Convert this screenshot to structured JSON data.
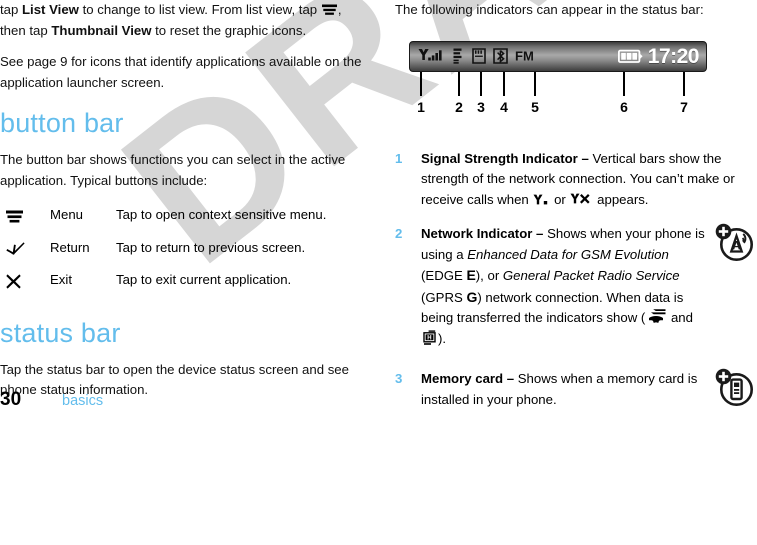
{
  "document": {
    "watermark": "DRAFT",
    "accent_color": "#63bdec",
    "page_number": "30",
    "chapter": "basics"
  },
  "left_column": {
    "intro_paragraph": {
      "before_bold1": "tap ",
      "bold1": "List View",
      "mid": " to change to list view. From list view, tap ",
      "icon1": "menu-icon",
      "after_icon": ", then tap ",
      "bold2": "Thumbnail View",
      "tail": " to reset the graphic icons."
    },
    "see_page_paragraph": "See page 9 for icons that identify applications available on the application launcher screen.",
    "button_bar": {
      "heading": "button bar",
      "description": "The button bar shows functions you can select in the active application. Typical buttons include:",
      "rows": [
        {
          "icon": "menu-icon",
          "term": "Menu",
          "description": "Tap to open context sensitive menu."
        },
        {
          "icon": "return-arrow-icon",
          "term": "Return",
          "description": "Tap to return to previous screen."
        },
        {
          "icon": "exit-x-icon",
          "term": "Exit",
          "description": "Tap to exit current application."
        }
      ]
    },
    "status_bar_section": {
      "heading": "status bar",
      "description": "Tap the status bar to open the device status screen and see phone status information."
    }
  },
  "right_column": {
    "intro": "The following indicators can appear in the status bar:",
    "figure": {
      "clock": "17:20",
      "indicators": [
        {
          "id": "signal-strength-icon",
          "label": "1"
        },
        {
          "id": "edge-network-icon",
          "label": "2"
        },
        {
          "id": "memory-card-icon",
          "label": "3"
        },
        {
          "id": "bluetooth-icon",
          "label": "4"
        },
        {
          "id": "fm-radio-icon",
          "label": "5"
        },
        {
          "id": "battery-icon",
          "label": "6"
        },
        {
          "id": "clock-text",
          "label": "7"
        }
      ],
      "fm_label": "FM",
      "edge_letter": "E"
    },
    "items": [
      {
        "num": "1",
        "title": "Signal Strength Indicator",
        "dash": " – ",
        "text_a": "Vertical bars show the strength of the network connection. You can’t make or receive calls when ",
        "text_b": " or ",
        "text_c": " appears.",
        "margin_icon": null
      },
      {
        "num": "2",
        "title": "Network Indicator",
        "dash": " – ",
        "text_a": "Shows when your phone is using a ",
        "italic_a": "Enhanced Data for GSM Evolution",
        "text_b": " (EDGE ",
        "letter_edge": "E",
        "text_c": "), or ",
        "italic_b": "General Packet Radio Service",
        "text_d": " (GPRS ",
        "letter_gprs": "G",
        "text_e": ") network connection. When data is being transferred the indicators show (",
        "text_f": " and ",
        "text_g": ").",
        "margin_icon": "network-tower-add-icon"
      },
      {
        "num": "3",
        "title": "Memory card",
        "dash": " – ",
        "text_a": "Shows when a memory card is installed in your phone.",
        "margin_icon": "phone-add-icon"
      }
    ]
  }
}
